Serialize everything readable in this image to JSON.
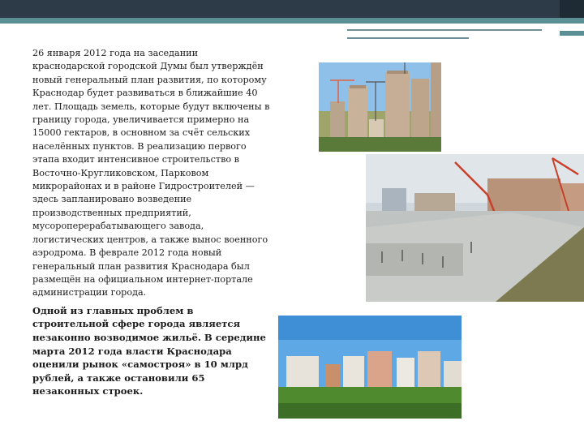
{
  "slide": {
    "paragraph_1": "26 января 2012 года на заседании краснодарской городской Думы был утверждён новый генеральный план развития, по которому Краснодар будет развиваться в ближайшие 40 лет. Площадь земель, которые будут включены в границу города, увеличивается примерно на 15000 гектаров, в основном за счёт сельских населённых пунктов. В реализацию первого этапа входит интенсивное строительство в Восточно-Кругликовском, Парковом микрорайонах и в районе Гидростроителей — здесь запланировано возведение производственных предприятий, мусороперерабатывающего завода, логистических центров, а также вынос военного аэродрома. В феврале 2012 года новый генеральный план развития Краснодара был размещён на официальном интернет-портале администрации города.",
    "paragraph_2": "Одной из главных проблем в строительной сфере города является незаконно возводимое жильё. В середине марта 2012 года власти Краснодара оценили рынок «самостроя» в 10 млрд рублей, а также остановили 65 незаконных строек."
  },
  "theme": {
    "header_dark": "#2c3b47",
    "header_accent": "#5b8f93"
  }
}
